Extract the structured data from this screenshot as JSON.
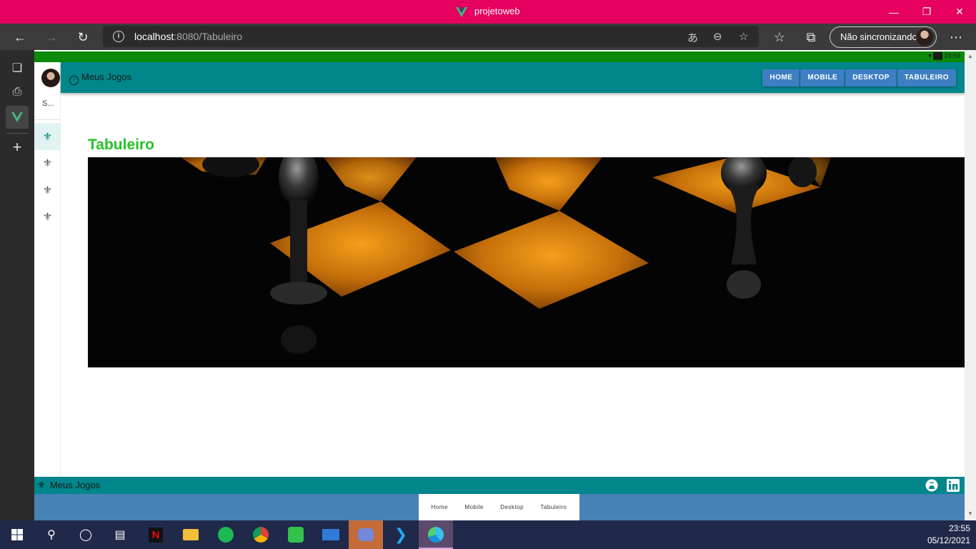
{
  "window": {
    "title": "projetoweb"
  },
  "browser": {
    "url_host": "localhost",
    "url_rest": ":8080/Tabuleiro",
    "sync_label": "Não sincronizando"
  },
  "status_bar": {
    "time": "23:59"
  },
  "drawer": {
    "user_name": "S...",
    "items": [
      {
        "icon": "fleur-de-lis-icon",
        "active": true
      },
      {
        "icon": "fleur-de-lis-icon",
        "active": false
      },
      {
        "icon": "fleur-de-lis-icon",
        "active": false
      },
      {
        "icon": "fleur-de-lis-icon",
        "active": false
      }
    ]
  },
  "app_bar": {
    "brand": "Meus Jogos",
    "nav": [
      "HOME",
      "MOBILE",
      "DESKTOP",
      "TABULEIRO"
    ]
  },
  "main": {
    "heading": "Tabuleiro"
  },
  "footer": {
    "brand": "Meus Jogos",
    "links": [
      "Home",
      "Mobile",
      "Desktop",
      "Tabuleiro"
    ],
    "social": [
      "github-icon",
      "linkedin-icon"
    ]
  },
  "taskbar": {
    "time": "23:55",
    "date": "05/12/2021"
  },
  "colors": {
    "titlebar": "#e6005f",
    "appbar": "#00868b",
    "nav_button": "#3d7fc2",
    "heading": "#27c127",
    "status_bar": "#0b8a0b",
    "footer_nav": "#4682b4"
  }
}
